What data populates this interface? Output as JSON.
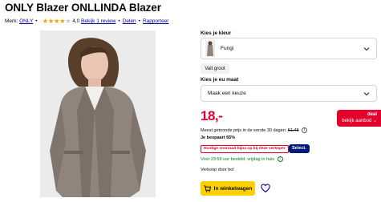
{
  "product": {
    "title": "ONLY Blazer ONLLINDA Blazer",
    "brand_label": "Merk:",
    "brand": "ONLY",
    "rating_value": "4,0",
    "rating_stars": 4,
    "review_link": "Bekijk 1 review",
    "share_link": "Delen",
    "report_link": "Rapporteer"
  },
  "options": {
    "color_label": "Kies je kleur",
    "color_value": "Fungi",
    "size_chip": "Valt groot",
    "size_label": "Kies je eu maat",
    "size_value": "Maak een keuze"
  },
  "pricing": {
    "price": "18,-",
    "deal_title": "deal",
    "deal_link": "bekijk aanbod",
    "lowest_price_text": "Meest getoonde prijs in de eerste 30 dagen:",
    "lowest_price_value": "51,45",
    "savings": "Je bespaart 65%"
  },
  "delivery": {
    "promo_badge": "Huidige voorraad bijna op bij deze verkoper",
    "select_badge": "Select.",
    "delivery_text": "Voor 23:59 uur besteld, vrijdag in huis",
    "seller": "Verkoop door bol"
  },
  "actions": {
    "cart_button": "In winkelwagen"
  },
  "colors": {
    "accent_red": "#e4002b",
    "link_blue": "#0000a4",
    "star_yellow": "#f7a600",
    "cart_yellow": "#ffd000",
    "select_navy": "#001a77",
    "delivery_green": "#00811f"
  },
  "icons": [
    "star-icon",
    "chevron-down-icon",
    "info-icon",
    "cart-icon",
    "heart-icon"
  ]
}
